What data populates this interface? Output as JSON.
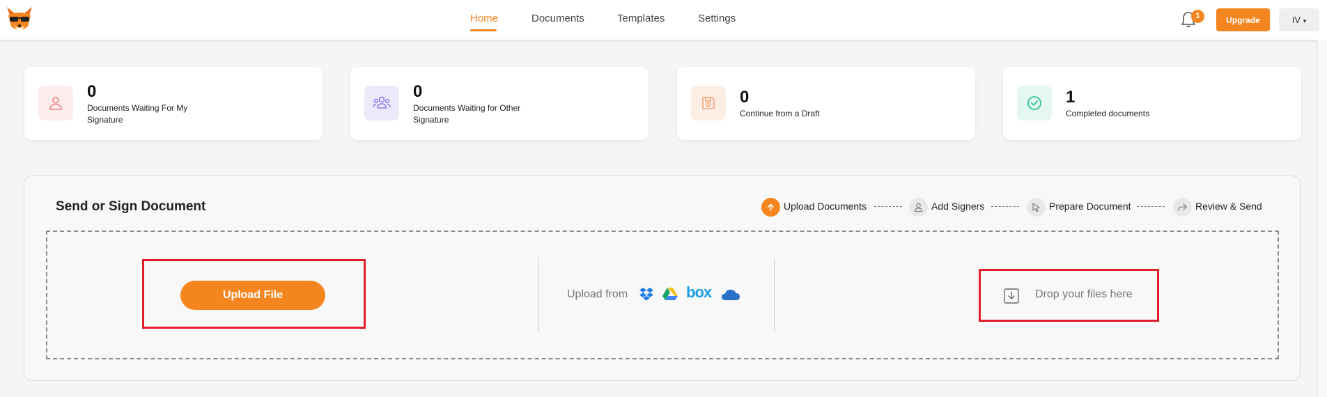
{
  "nav": {
    "items": [
      {
        "label": "Home",
        "active": true
      },
      {
        "label": "Documents",
        "active": false
      },
      {
        "label": "Templates",
        "active": false
      },
      {
        "label": "Settings",
        "active": false
      }
    ],
    "notification_count": "1",
    "upgrade_label": "Upgrade",
    "user_initials": "IV",
    "caret": "▾"
  },
  "stats": [
    {
      "count": "0",
      "label": "Documents Waiting For My Signature",
      "icon": "user-icon",
      "bg": "#fdecec",
      "fg": "#f08080"
    },
    {
      "count": "0",
      "label": "Documents Waiting for Other Signature",
      "icon": "users-icon",
      "bg": "#ece9fb",
      "fg": "#8c7ae6"
    },
    {
      "count": "0",
      "label": "Continue from a Draft",
      "icon": "save-icon",
      "bg": "#fdeee4",
      "fg": "#f2a57a"
    },
    {
      "count": "1",
      "label": "Completed documents",
      "icon": "check-circle-icon",
      "bg": "#e4f8f0",
      "fg": "#2fc48d"
    }
  ],
  "panel": {
    "title": "Send or Sign Document",
    "steps": [
      {
        "label": "Upload Documents",
        "icon": "upload-icon",
        "active": true
      },
      {
        "label": "Add Signers",
        "icon": "user-icon",
        "active": false
      },
      {
        "label": "Prepare Document",
        "icon": "cursor-icon",
        "active": false
      },
      {
        "label": "Review & Send",
        "icon": "share-icon",
        "active": false
      }
    ],
    "upload_button_label": "Upload File",
    "upload_from_label": "Upload from",
    "cloud_sources": [
      "dropbox-icon",
      "google-drive-icon",
      "box-icon",
      "onedrive-icon"
    ],
    "box_label": "box",
    "drop_label": "Drop your files here"
  },
  "colors": {
    "accent": "#f5861f",
    "highlight": "#e11d2a"
  }
}
